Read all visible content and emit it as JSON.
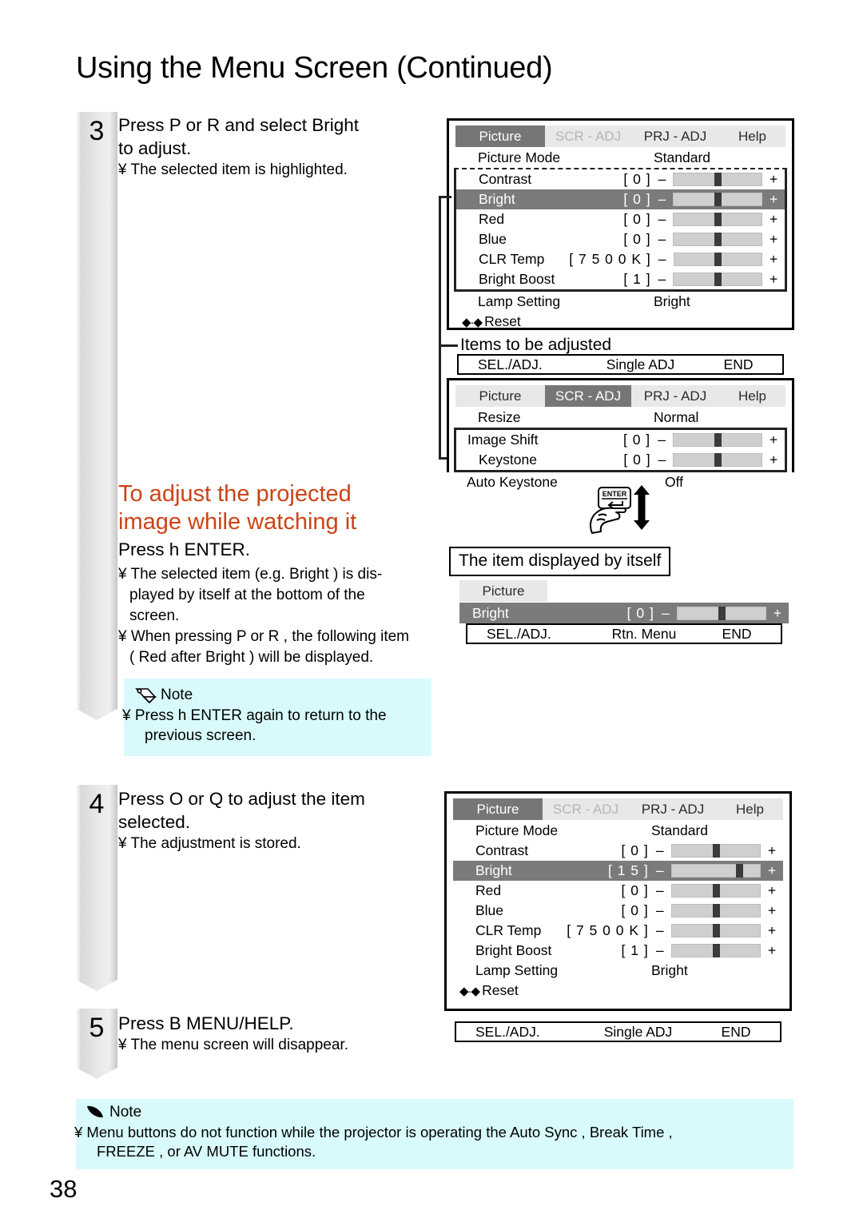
{
  "page": {
    "title": "Using the Menu Screen (Continued)",
    "number": "38"
  },
  "steps": [
    {
      "number": "3",
      "lead_line1": "Press  P  or  R  and select   Bright",
      "lead_line2": "to adjust.",
      "bullets": [
        "¥ The selected item is highlighted."
      ]
    },
    {
      "number": "4",
      "lead_line1": "Press  O  or  Q  to adjust the item",
      "lead_line2": "selected.",
      "bullets": [
        "¥ The adjustment is stored."
      ]
    },
    {
      "number": "5",
      "lead_line1": "Press  B  MENU/HELP.",
      "lead_line2": "",
      "bullets": [
        "¥ The menu screen will disappear."
      ]
    }
  ],
  "section": {
    "heading_line1": "To adjust the projected",
    "heading_line2": "image while watching it",
    "heading_color": "#cc4316",
    "lead": "Press  h   ENTER.",
    "bullets": [
      "¥ The selected item (e.g.  Bright ) is dis-played by itself at the bottom of the screen.",
      "¥ When pressing P  or R , the following item ( Red  after  Bright ) will be displayed."
    ],
    "bullet1_lines": [
      "¥ The selected item (e.g.  Bright ) is dis-",
      "played by itself at the bottom of the",
      "screen."
    ],
    "bullet2_lines": [
      "¥ When pressing P  or R , the following item",
      "( Red  after  Bright ) will be displayed."
    ]
  },
  "notes": [
    {
      "icon": "pencil-icon",
      "label": "Note",
      "lines": [
        "¥ Press h   ENTER again to return to the",
        "previous screen."
      ],
      "background": "#d9fafc"
    },
    {
      "icon": "pencil-icon",
      "label": "Note",
      "lines": [
        "¥ Menu  buttons  do  not  function  while  the  projector  is  operating  the  Auto Sync ,  Break Time ,",
        "FREEZE , or  AV MUTE  functions."
      ],
      "background": "#d9fafc"
    }
  ],
  "callouts": {
    "items_to_be_adjusted": "Items to be adjusted",
    "item_displayed_by_itself": "The item displayed by itself",
    "enter_key": "ENTER"
  },
  "osd": {
    "tabs": [
      "Picture",
      "SCR - ADJ",
      "PRJ - ADJ",
      "Help"
    ],
    "footer": {
      "sel_adj": "SEL./ADJ.",
      "single_adj": "Single ADJ",
      "rtn_menu": "Rtn. Menu",
      "end": "END"
    },
    "picture_panel_1": {
      "active_tab": "Picture",
      "picture_mode": {
        "label": "Picture Mode",
        "value": "Standard"
      },
      "rows": [
        {
          "label": "Contrast",
          "value": "[      0 ]",
          "minus": "–",
          "plus": "+",
          "thumb_pct": 50,
          "highlight": false
        },
        {
          "label": "Bright",
          "value": "[      0 ]",
          "minus": "–",
          "plus": "+",
          "thumb_pct": 50,
          "highlight": true
        },
        {
          "label": "Red",
          "value": "[      0 ]",
          "minus": "–",
          "plus": "+",
          "thumb_pct": 50,
          "highlight": false
        },
        {
          "label": "Blue",
          "value": "[      0 ]",
          "minus": "–",
          "plus": "+",
          "thumb_pct": 50,
          "highlight": false
        },
        {
          "label": "CLR Temp",
          "value": "[  7 5 0 0 K ]",
          "minus": "–",
          "plus": "+",
          "thumb_pct": 50,
          "highlight": false
        },
        {
          "label": "Bright Boost",
          "value": "[      1 ]",
          "minus": "–",
          "plus": "+",
          "thumb_pct": 50,
          "highlight": false
        }
      ],
      "lamp_setting": {
        "label": "Lamp Setting",
        "value": "Bright"
      },
      "reset": {
        "glyph": "◆·◆",
        "label": "Reset"
      }
    },
    "scr_adj_panel": {
      "active_tab": "SCR - ADJ",
      "resize": {
        "label": "Resize",
        "value": "Normal"
      },
      "rows": [
        {
          "label": "Image Shift",
          "value": "[      0 ]",
          "minus": "–",
          "plus": "+",
          "thumb_pct": 50,
          "highlight": false
        },
        {
          "label": "Keystone",
          "value": "[      0 ]",
          "minus": "–",
          "plus": "+",
          "thumb_pct": 50,
          "highlight": false
        }
      ],
      "auto_keystone": {
        "label": "Auto Keystone",
        "value": "Off"
      }
    },
    "single_item_panel": {
      "tab": "Picture",
      "row": {
        "label": "Bright",
        "value": "[      0 ]",
        "minus": "–",
        "plus": "+",
        "thumb_pct": 50,
        "highlight": true
      }
    },
    "picture_panel_2": {
      "active_tab": "Picture",
      "picture_mode": {
        "label": "Picture Mode",
        "value": "Standard"
      },
      "rows": [
        {
          "label": "Contrast",
          "value": "[      0 ]",
          "minus": "–",
          "plus": "+",
          "thumb_pct": 50,
          "highlight": false
        },
        {
          "label": "Bright",
          "value": "[    1 5 ]",
          "minus": "–",
          "plus": "+",
          "thumb_pct": 76,
          "highlight": true
        },
        {
          "label": "Red",
          "value": "[      0 ]",
          "minus": "–",
          "plus": "+",
          "thumb_pct": 50,
          "highlight": false
        },
        {
          "label": "Blue",
          "value": "[      0 ]",
          "minus": "–",
          "plus": "+",
          "thumb_pct": 50,
          "highlight": false
        },
        {
          "label": "CLR Temp",
          "value": "[  7 5 0 0 K ]",
          "minus": "–",
          "plus": "+",
          "thumb_pct": 50,
          "highlight": false
        },
        {
          "label": "Bright Boost",
          "value": "[      1 ]",
          "minus": "–",
          "plus": "+",
          "thumb_pct": 50,
          "highlight": false
        }
      ],
      "lamp_setting": {
        "label": "Lamp Setting",
        "value": "Bright"
      },
      "reset": {
        "glyph": "◆·◆",
        "label": "Reset"
      }
    }
  }
}
